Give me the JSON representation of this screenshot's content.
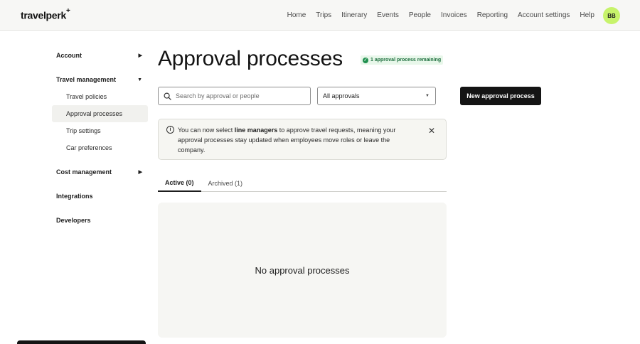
{
  "brand": {
    "logo": "travelperk",
    "logo_plus": "+"
  },
  "nav": {
    "items": [
      "Home",
      "Trips",
      "Itinerary",
      "Events",
      "People",
      "Invoices",
      "Reporting",
      "Account settings",
      "Help"
    ],
    "avatar_initials": "BB"
  },
  "sidebar": {
    "account": "Account",
    "travel_management": "Travel management",
    "sub_items": [
      "Travel policies",
      "Approval processes",
      "Trip settings",
      "Car preferences"
    ],
    "active_sub_item": "Approval processes",
    "cost_management": "Cost management",
    "integrations": "Integrations",
    "developers": "Developers"
  },
  "main": {
    "title": "Approval processes",
    "badge": "1 approval process remaining",
    "search_placeholder": "Search by approval or people",
    "filter_selected": "All approvals",
    "new_button": "New approval process",
    "info": {
      "prefix": "You can now select ",
      "highlight": "line managers",
      "suffix": " to approve travel requests, meaning your approval processes stay updated when employees move roles or leave the company."
    },
    "tabs": [
      "Active (0)",
      "Archived (1)"
    ],
    "empty_state": "No approval processes"
  },
  "colors": {
    "accent_avatar": "#c7f36b",
    "badge_bg": "#e8f7ea",
    "badge_text": "#1b6d3c",
    "primary_button": "#141414"
  }
}
